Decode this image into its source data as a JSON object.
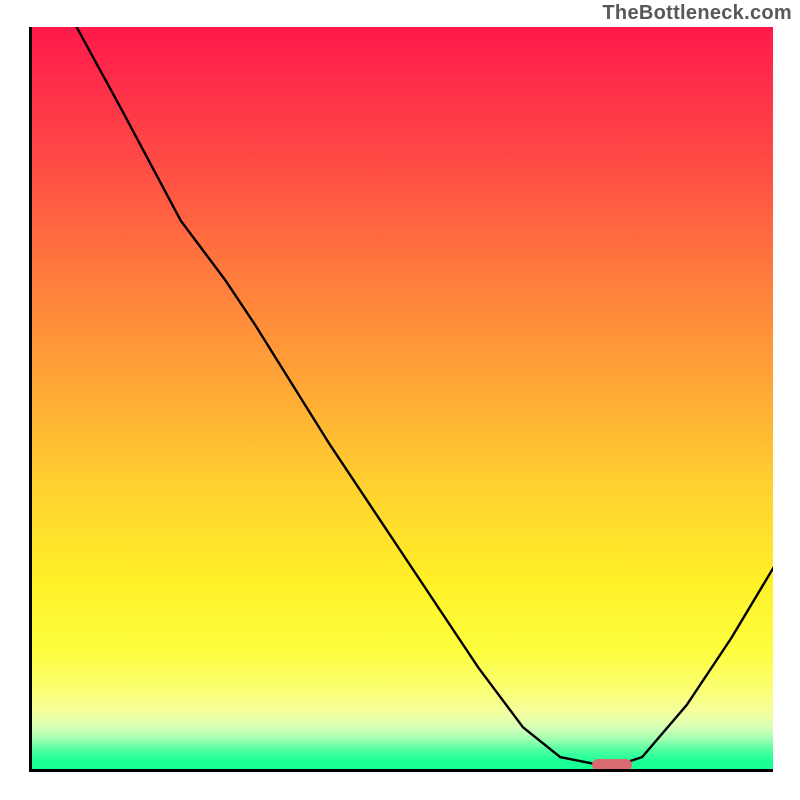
{
  "watermark": "TheBottleneck.com",
  "chart_data": {
    "type": "line",
    "title": "",
    "xlabel": "",
    "ylabel": "",
    "xlim": [
      0,
      100
    ],
    "ylim": [
      0,
      100
    ],
    "grid": false,
    "legend": false,
    "series": [
      {
        "name": "curve",
        "x": [
          6,
          12,
          20,
          26,
          30,
          40,
          50,
          60,
          66,
          71,
          76,
          79,
          82,
          88,
          94,
          100
        ],
        "values": [
          100,
          89,
          74,
          66,
          60,
          44,
          29,
          14,
          6,
          2,
          1,
          1,
          2,
          9,
          18,
          28
        ]
      }
    ],
    "marker": {
      "x": 78,
      "y": 1
    },
    "background_gradient": {
      "top": "#ff194a",
      "mid": "#ffd12f",
      "bottom": "#17ff93"
    }
  }
}
